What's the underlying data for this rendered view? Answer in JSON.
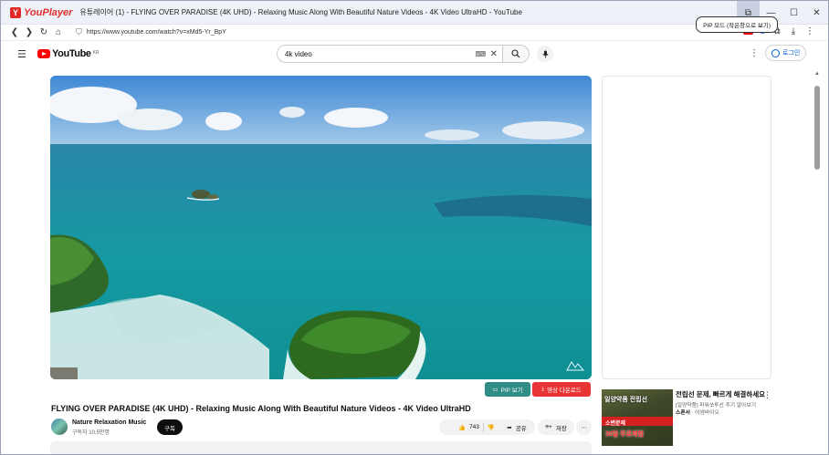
{
  "app": {
    "logo_letter": "Y",
    "name": "YouPlayer",
    "window_title": "유튜레이어 (1) - FLYING OVER PARADISE (4K UHD) - Relaxing Music Along With Beautiful Nature Videos - 4K Video UltraHD - YouTube"
  },
  "window_controls": {
    "pip": "⧉",
    "minimize": "—",
    "maximize": "☐",
    "close": "✕"
  },
  "address": {
    "url": "https://www.youtube.com/watch?v=xMd5-Yr_BpY"
  },
  "tooltip": "PIP 모드 (작은창으로 보기)",
  "youtube_header": {
    "logo_text": "YouTube",
    "region": "KR",
    "search_value": "4k video",
    "login_label": "로그인"
  },
  "video": {
    "title": "FLYING OVER PARADISE (4K UHD) - Relaxing Music Along With Beautiful Nature Videos - 4K Video UltraHD",
    "channel_name": "Nature Relaxation Music",
    "subscribers": "구독자 10.5만명",
    "subscribe_label": "구독",
    "likes": "743",
    "share_label": "공유",
    "save_label": "저장",
    "pip_label": "PIP 보기",
    "download_label": "영상 다운로드"
  },
  "sidebar_ad": {
    "title": "전립선 문제, 빠르게 해결하세요",
    "description": "[일양약품] 파워쏘투선 후기 알아보기",
    "sponsor_label": "스폰서",
    "sponsor_name": "어썸바이오",
    "thumb_line1": "일양약품 전립선",
    "thumb_line2": "소변문제",
    "thumb_line3": "30일 무료체험"
  },
  "colors": {
    "youtube_red": "#ff0000",
    "pip_button": "#2f8c86",
    "download_button": "#e83434",
    "link_blue": "#065fd4"
  }
}
